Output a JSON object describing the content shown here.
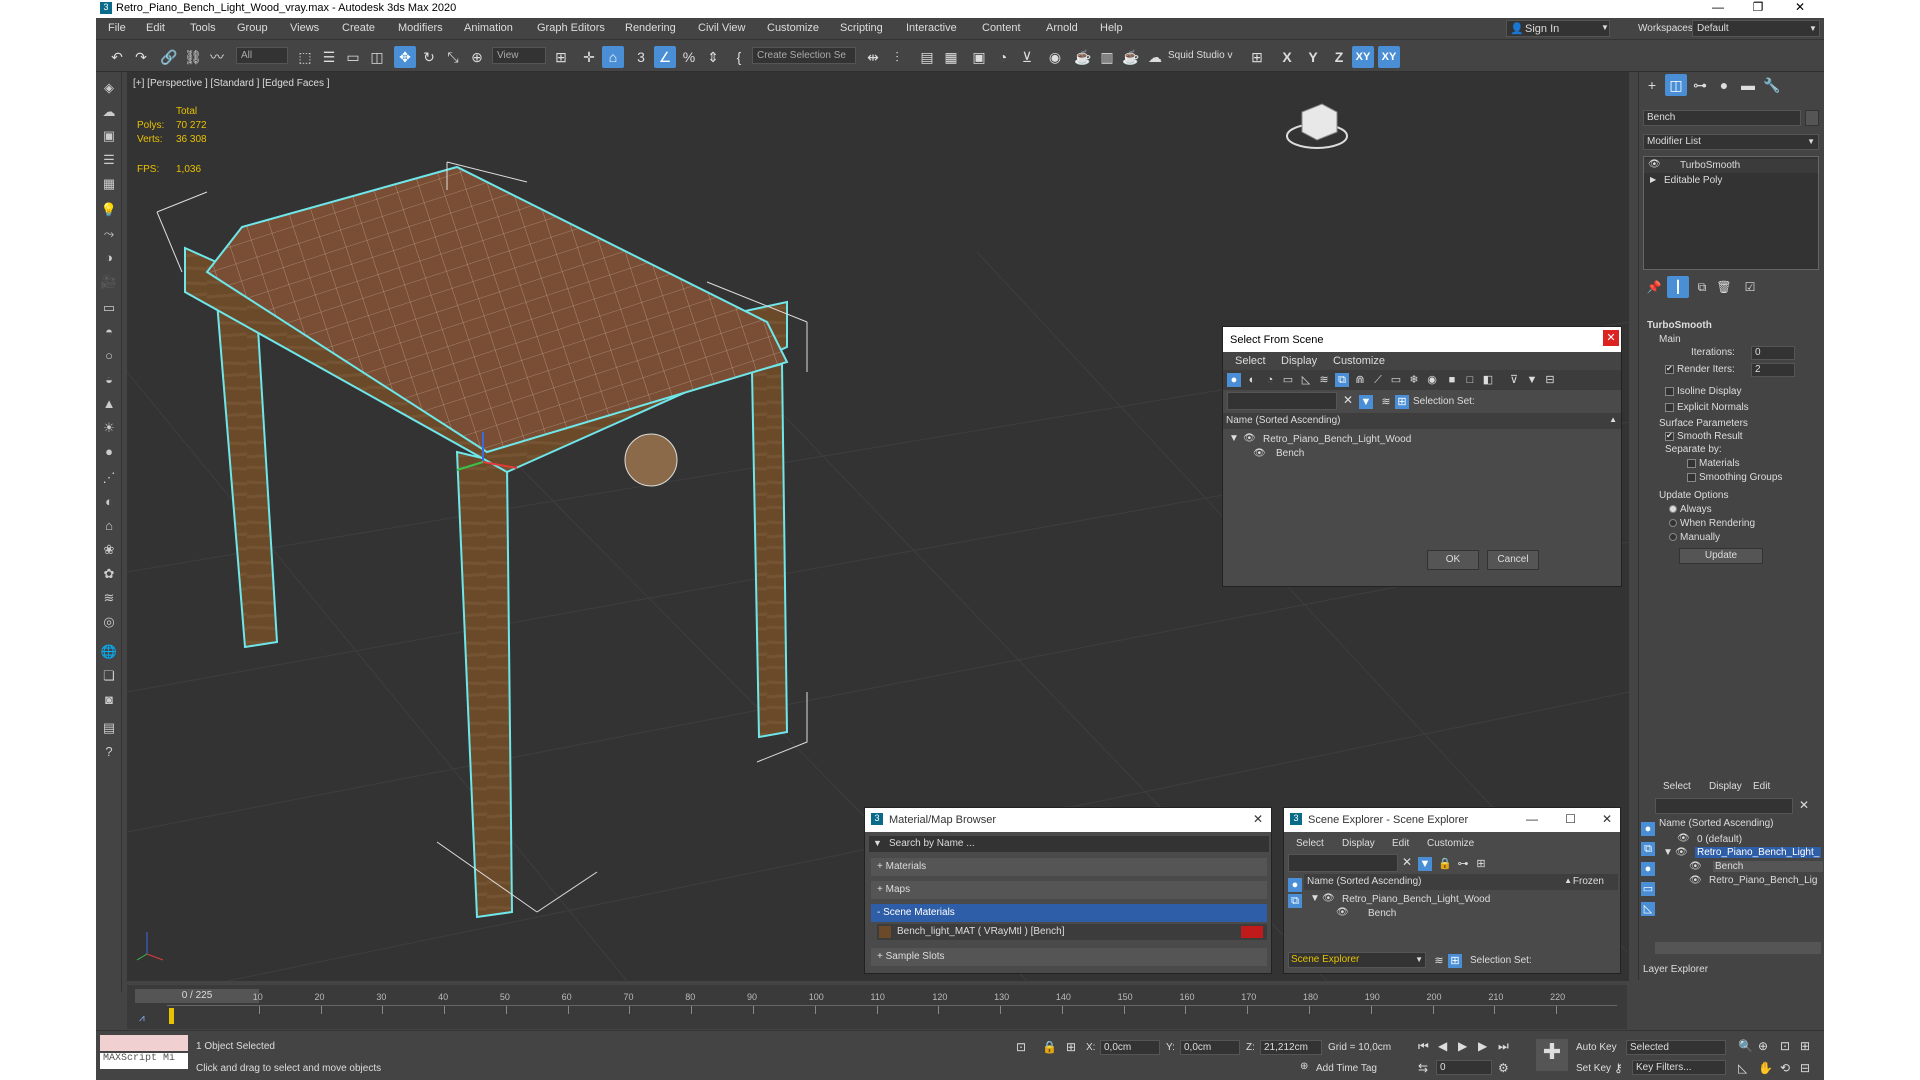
{
  "window": {
    "title": "Retro_Piano_Bench_Light_Wood_vray.max - Autodesk 3ds Max 2020"
  },
  "menu": [
    "File",
    "Edit",
    "Tools",
    "Group",
    "Views",
    "Create",
    "Modifiers",
    "Animation",
    "Graph Editors",
    "Rendering",
    "Civil View",
    "Customize",
    "Scripting",
    "Interactive",
    "Content",
    "Arnold",
    "Help"
  ],
  "signin": {
    "label": "Sign In"
  },
  "workspaces": {
    "label": "Workspaces:",
    "value": "Default"
  },
  "toolbar": {
    "filter_value": "All",
    "refcoord_value": "View",
    "selection_set": "Create Selection Se",
    "squid": "Squid Studio v",
    "axes": [
      "X",
      "Y",
      "Z",
      "XY",
      "XY"
    ]
  },
  "viewport": {
    "label": "[+] [Perspective ] [Standard ] [Edged Faces ]",
    "stats": {
      "total": "Total",
      "polys_label": "Polys:",
      "polys": "70 272",
      "verts_label": "Verts:",
      "verts": "36 308",
      "fps_label": "FPS:",
      "fps": "1,036"
    }
  },
  "select_from_scene": {
    "title": "Select From Scene",
    "menus": [
      "Select",
      "Display",
      "Customize"
    ],
    "selection_set_label": "Selection Set:",
    "column_header": "Name (Sorted Ascending)",
    "items": [
      "Retro_Piano_Bench_Light_Wood",
      "Bench"
    ],
    "ok": "OK",
    "cancel": "Cancel"
  },
  "material_browser": {
    "title": "Material/Map Browser",
    "search_placeholder": "Search by Name ...",
    "rollouts": [
      "+ Materials",
      "+ Maps",
      "- Scene Materials",
      "+ Sample Slots"
    ],
    "material_entry": "Bench_light_MAT  ( VRayMtl )  [Bench]"
  },
  "scene_explorer": {
    "title": "Scene Explorer - Scene Explorer",
    "menus": [
      "Select",
      "Display",
      "Edit",
      "Customize"
    ],
    "column_header": "Name (Sorted Ascending)",
    "frozen_header": "Frozen",
    "items": [
      "Retro_Piano_Bench_Light_Wood",
      "Bench"
    ],
    "footer_value": "Scene Explorer",
    "selection_set_label": "Selection Set:"
  },
  "command_panel": {
    "object_name": "Bench",
    "modifier_list": "Modifier List",
    "stack": [
      "TurboSmooth",
      "Editable Poly"
    ],
    "rollout_title": "TurboSmooth",
    "main": "Main",
    "iterations_label": "Iterations:",
    "iterations": "0",
    "render_iters_label": "Render Iters:",
    "render_iters": "2",
    "isoline": "Isoline Display",
    "explicit": "Explicit Normals",
    "surface_params": "Surface Parameters",
    "smooth_result": "Smooth Result",
    "separate_by": "Separate by:",
    "materials": "Materials",
    "smoothing_groups": "Smoothing Groups",
    "update_options": "Update Options",
    "always": "Always",
    "when_rendering": "When Rendering",
    "manually": "Manually",
    "update": "Update"
  },
  "layer_explorer": {
    "menus": [
      "Select",
      "Display",
      "Edit"
    ],
    "column_header": "Name (Sorted Ascending)",
    "items": [
      "0 (default)",
      "Retro_Piano_Bench_Light_",
      "Bench",
      "Retro_Piano_Bench_Lig"
    ],
    "footer": "Layer Explorer"
  },
  "timeline": {
    "frame": "0 / 225",
    "ticks": [
      "10",
      "20",
      "30",
      "40",
      "50",
      "60",
      "70",
      "80",
      "90",
      "100",
      "110",
      "120",
      "130",
      "140",
      "150",
      "160",
      "170",
      "180",
      "190",
      "200",
      "210",
      "220"
    ]
  },
  "status": {
    "maxscript": "MAXScript Mi",
    "selected": "1 Object Selected",
    "hint": "Click and drag to select and move objects",
    "x_label": "X:",
    "x": "0,0cm",
    "y_label": "Y:",
    "y": "0,0cm",
    "z_label": "Z:",
    "z": "21,212cm",
    "grid": "Grid = 10,0cm",
    "add_time_tag": "Add Time Tag",
    "auto_key": "Auto Key",
    "selected_dd": "Selected",
    "set_key": "Set Key",
    "key_filters": "Key Filters...",
    "frame_field": "0"
  }
}
